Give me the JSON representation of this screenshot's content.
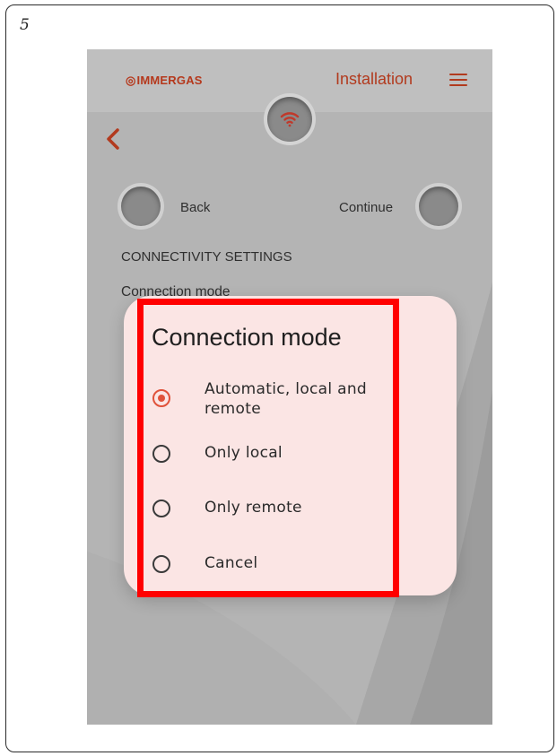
{
  "page": {
    "number": "5"
  },
  "app": {
    "brand": "IMMERGAS",
    "brand_mark": "◎",
    "header_link": "Installation",
    "accent_color": "#b23a1e"
  },
  "nav": {
    "back_label": "Back",
    "continue_label": "Continue"
  },
  "content": {
    "section_title": "CONNECTIVITY SETTINGS",
    "field_label": "Connection mode"
  },
  "dialog": {
    "title": "Connection mode",
    "selected_index": 0,
    "radio_color": "#e0523a",
    "options": [
      {
        "label": "Automatic, local and remote",
        "checked": true
      },
      {
        "label": "Only local",
        "checked": false
      },
      {
        "label": "Only remote",
        "checked": false
      },
      {
        "label": "Cancel",
        "checked": false
      }
    ]
  },
  "annotation": {
    "highlight_color": "#ff0000"
  },
  "icons": [
    "wifi-icon",
    "back-chevron-icon",
    "menu-icon"
  ]
}
